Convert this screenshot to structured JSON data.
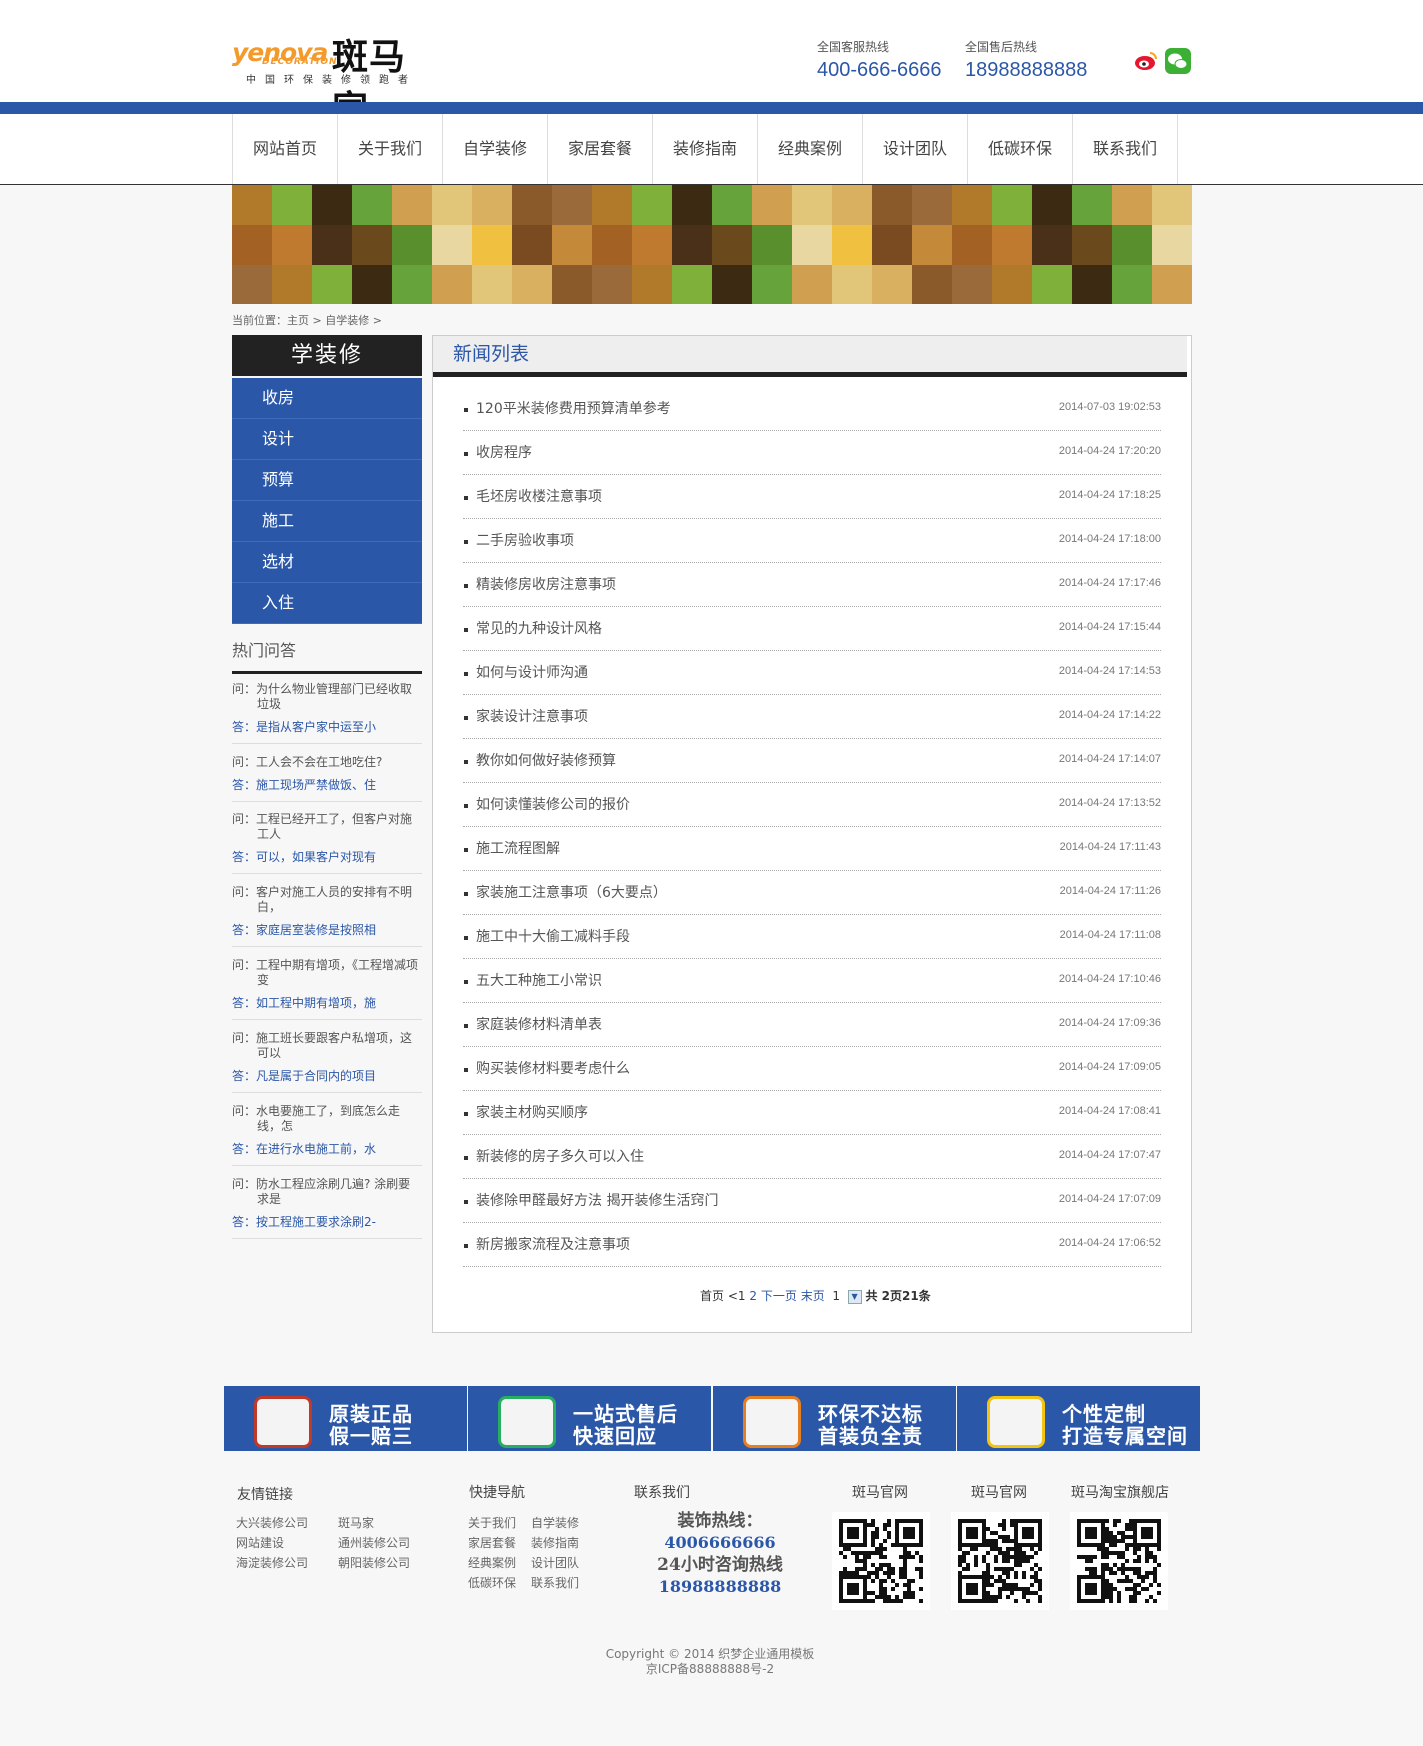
{
  "header": {
    "logo_en": "yenova",
    "logo_en2": "DECORATION",
    "logo_cn": "斑马家",
    "logo_slogan": "中国环保装修领跑者",
    "hotline1_label": "全国客服热线",
    "hotline1_number": "400-666-6666",
    "hotline2_label": "全国售后热线",
    "hotline2_number": "18988888888",
    "social_icons": [
      "weibo-icon",
      "wechat-icon"
    ]
  },
  "nav": [
    "网站首页",
    "关于我们",
    "自学装修",
    "家居套餐",
    "装修指南",
    "经典案例",
    "设计团队",
    "低碳环保",
    "联系我们"
  ],
  "breadcrumb": "当前位置：主页 > 自学装修 >",
  "sidebar": {
    "title": "学装修",
    "items": [
      "收房",
      "设计",
      "预算",
      "施工",
      "选材",
      "入住"
    ],
    "faq_title": "热门问答",
    "faq": [
      {
        "q": "问：为什么物业管理部门已经收取垃圾",
        "a": "答：是指从客户家中运至小"
      },
      {
        "q": "问：工人会不会在工地吃住?",
        "a": "答：施工现场严禁做饭、住"
      },
      {
        "q": "问：工程已经开工了，但客户对施工人",
        "a": "答：可以，如果客户对现有"
      },
      {
        "q": "问：客户对施工人员的安排有不明白，",
        "a": "答：家庭居室装修是按照相"
      },
      {
        "q": "问：工程中期有增项，《工程增减项变",
        "a": "答：如工程中期有增项，施"
      },
      {
        "q": "问：施工班长要跟客户私增项，这可以",
        "a": "答：凡是属于合同内的项目"
      },
      {
        "q": "问：水电要施工了，到底怎么走线，怎",
        "a": "答：在进行水电施工前，水"
      },
      {
        "q": "问：防水工程应涂刷几遍? 涂刷要求是",
        "a": "答：按工程施工要求涂刷2-"
      }
    ]
  },
  "main": {
    "title": "新闻列表",
    "news": [
      {
        "title": "120平米装修费用预算清单参考",
        "date": "2014-07-03 19:02:53"
      },
      {
        "title": "收房程序",
        "date": "2014-04-24 17:20:20"
      },
      {
        "title": "毛坯房收楼注意事项",
        "date": "2014-04-24 17:18:25"
      },
      {
        "title": "二手房验收事项",
        "date": "2014-04-24 17:18:00"
      },
      {
        "title": "精装修房收房注意事项",
        "date": "2014-04-24 17:17:46"
      },
      {
        "title": "常见的九种设计风格",
        "date": "2014-04-24 17:15:44"
      },
      {
        "title": "如何与设计师沟通",
        "date": "2014-04-24 17:14:53"
      },
      {
        "title": "家装设计注意事项",
        "date": "2014-04-24 17:14:22"
      },
      {
        "title": "教你如何做好装修预算",
        "date": "2014-04-24 17:14:07"
      },
      {
        "title": "如何读懂装修公司的报价",
        "date": "2014-04-24 17:13:52"
      },
      {
        "title": "施工流程图解",
        "date": "2014-04-24 17:11:43"
      },
      {
        "title": "家装施工注意事项（6大要点）",
        "date": "2014-04-24 17:11:26"
      },
      {
        "title": "施工中十大偷工减料手段",
        "date": "2014-04-24 17:11:08"
      },
      {
        "title": "五大工种施工小常识",
        "date": "2014-04-24 17:10:46"
      },
      {
        "title": "家庭装修材料清单表",
        "date": "2014-04-24 17:09:36"
      },
      {
        "title": "购买装修材料要考虑什么",
        "date": "2014-04-24 17:09:05"
      },
      {
        "title": "家装主材购买顺序",
        "date": "2014-04-24 17:08:41"
      },
      {
        "title": "新装修的房子多久可以入住",
        "date": "2014-04-24 17:07:47"
      },
      {
        "title": "装修除甲醛最好方法 揭开装修生活窍门",
        "date": "2014-04-24 17:07:09"
      },
      {
        "title": "新房搬家流程及注意事项",
        "date": "2014-04-24 17:06:52"
      }
    ],
    "pager": {
      "first": "首页",
      "prev": "<1",
      "two": "2",
      "next": "下一页",
      "last": "末页",
      "cur": "1",
      "total": "共 2页21条"
    }
  },
  "features": [
    {
      "l1": "原装正品",
      "l2": "假一赔三",
      "icon": "checklist-icon",
      "color": "#c0392b"
    },
    {
      "l1": "一站式售后",
      "l2": "快速回应",
      "icon": "phone-icon",
      "color": "#27ae60"
    },
    {
      "l1": "环保不达标",
      "l2": "首装负全责",
      "icon": "question-book-icon",
      "color": "#e67e22"
    },
    {
      "l1": "个性定制",
      "l2": "打造专属空间",
      "icon": "id-card-icon",
      "color": "#f1c40f"
    }
  ],
  "footer": {
    "links_title": "友情链接",
    "links": [
      "大兴装修公司",
      "斑马家",
      "网站建设",
      "通州装修公司",
      "海淀装修公司",
      "朝阳装修公司"
    ],
    "quick_title": "快捷导航",
    "quick": [
      "关于我们",
      "自学装修",
      "家居套餐",
      "装修指南",
      "经典案例",
      "设计团队",
      "低碳环保",
      "联系我们"
    ],
    "contact_title": "联系我们",
    "contact_l1": "装饰热线：",
    "contact_l2": "4006666666",
    "contact_l3": "24小时咨询热线",
    "contact_l4": "18988888888",
    "qr_titles": [
      "斑马官网",
      "斑马官网",
      "斑马淘宝旗舰店"
    ],
    "copyright": "Copyright © 2014 织梦企业通用模板",
    "icp": "京ICP备88888888号-2"
  }
}
